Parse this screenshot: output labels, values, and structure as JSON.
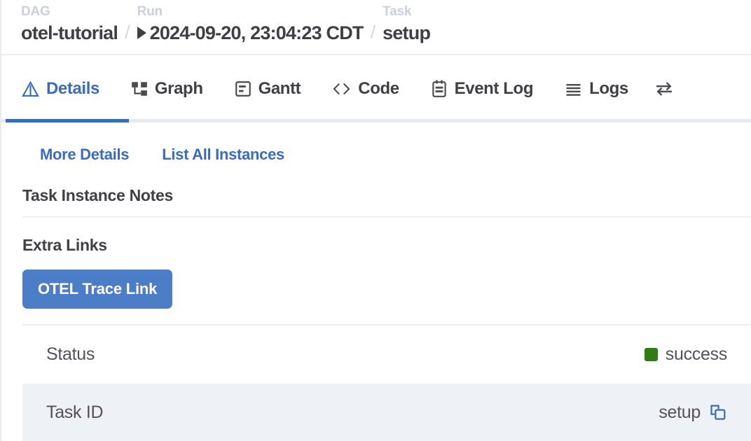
{
  "breadcrumb": {
    "dag": {
      "label": "DAG",
      "value": "otel-tutorial"
    },
    "run": {
      "label": "Run",
      "value": "2024-09-20, 23:04:23 CDT",
      "play_icon": "play-triangle-icon"
    },
    "task": {
      "label": "Task",
      "value": "setup"
    },
    "separator": "/"
  },
  "tabs": [
    {
      "label": "Details",
      "icon": "triangle-alert-icon",
      "active": true
    },
    {
      "label": "Graph",
      "icon": "hierarchy-graph-icon",
      "active": false
    },
    {
      "label": "Gantt",
      "icon": "gantt-chart-icon",
      "active": false
    },
    {
      "label": "Code",
      "icon": "code-brackets-icon",
      "active": false
    },
    {
      "label": "Event Log",
      "icon": "calendar-log-icon",
      "active": false
    },
    {
      "label": "Logs",
      "icon": "list-lines-icon",
      "active": false
    },
    {
      "label": "",
      "icon": "swap-arrows-icon",
      "active": false
    }
  ],
  "actions": {
    "more_details": "More Details",
    "list_all_instances": "List All Instances"
  },
  "sections": {
    "notes_title": "Task Instance Notes",
    "extra_links_title": "Extra Links",
    "extra_link_button": "OTEL Trace Link"
  },
  "details": [
    {
      "key": "Status",
      "value": "success",
      "status_color": "#2f7d16",
      "has_status_dot": true,
      "has_copy": false,
      "striped": false
    },
    {
      "key": "Task ID",
      "value": "setup",
      "has_status_dot": false,
      "has_copy": true,
      "striped": true
    }
  ],
  "colors": {
    "accent": "#3b6cb8",
    "button": "#4c7dc7",
    "success": "#2f7d16",
    "stripe": "#eef1f6",
    "text": "#3f3f46",
    "muted": "#cbd1dc"
  }
}
